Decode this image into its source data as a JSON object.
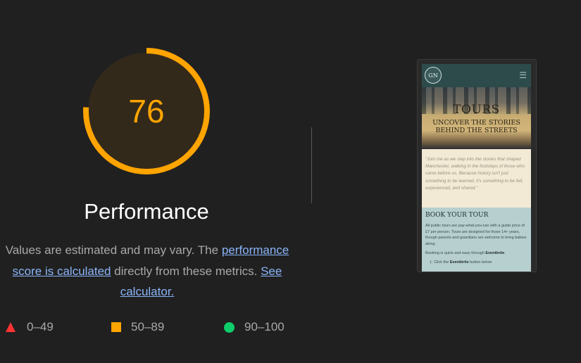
{
  "score": {
    "value": "76",
    "fraction": 0.76,
    "color": "#ffa400",
    "track_color": "#3a2e1e"
  },
  "category": {
    "title": "Performance"
  },
  "description": {
    "part1": "Values are estimated and may vary. The ",
    "link1": "performance score is calculated",
    "part2": " directly from these metrics. ",
    "link2": "See calculator."
  },
  "legend": [
    {
      "icon": "triangle-icon",
      "label": "0–49",
      "color": "#ff3333"
    },
    {
      "icon": "square-icon",
      "label": "50–89",
      "color": "#ffa400"
    },
    {
      "icon": "circle-icon",
      "label": "90–100",
      "color": "#0cce6b"
    }
  ],
  "thumbnail": {
    "logo_text": "GN",
    "menu_icon": "hamburger-icon",
    "hero_title": "TOURS",
    "hero_subtitle_line1": "UNCOVER THE STORIES",
    "hero_subtitle_line2": "BEHIND THE STREETS",
    "quote": "\"Join me as we step into the stories that shaped Manchester, walking in the footsteps of those who came before us. Because history isn't just something to be learned, it's something to be felt, experienced, and shared.\"",
    "book_title": "BOOK YOUR TOUR",
    "book_para1": "All public tours are pay-what-you-can with a guide price of £7 per person. Tours are designed for those 14+ years, though parents and guardians are welcome to bring babies along.",
    "book_para2_prefix": "Booking is quick and easy through ",
    "book_para2_link": "Eventbrite",
    "book_para2_suffix": ".",
    "book_step1_prefix": "1. Click the ",
    "book_step1_link": "Eventbrite",
    "book_step1_suffix": " button below"
  }
}
